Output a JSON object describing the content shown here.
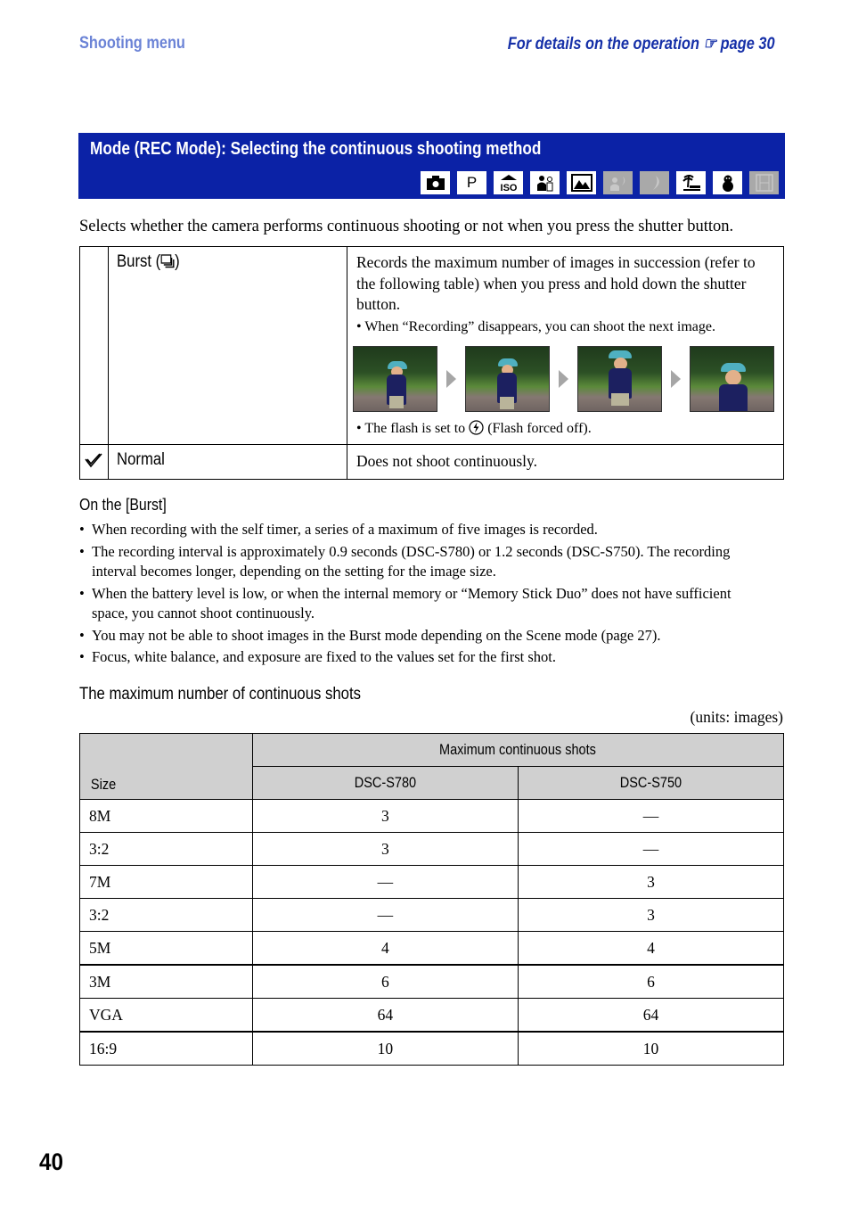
{
  "header": {
    "section": "Shooting menu",
    "reference": "For details on the operation ☞ page 30"
  },
  "banner": {
    "title": "Mode (REC Mode): Selecting the continuous shooting method",
    "mode_icons": [
      {
        "name": "auto-camera-icon",
        "glyph": "",
        "enabled": true
      },
      {
        "name": "program-icon",
        "glyph": "P",
        "enabled": true
      },
      {
        "name": "high-sensitivity-iso-icon",
        "glyph": "ISO",
        "enabled": true
      },
      {
        "name": "soft-snap-icon",
        "glyph": "",
        "enabled": true
      },
      {
        "name": "landscape-icon",
        "glyph": "",
        "enabled": true
      },
      {
        "name": "twilight-portrait-icon",
        "glyph": "",
        "enabled": false
      },
      {
        "name": "twilight-icon",
        "glyph": "",
        "enabled": false
      },
      {
        "name": "beach-icon",
        "glyph": "",
        "enabled": true
      },
      {
        "name": "snow-icon",
        "glyph": "",
        "enabled": true
      },
      {
        "name": "movie-icon",
        "glyph": "",
        "enabled": false
      }
    ]
  },
  "intro": "Selects whether the camera performs continuous shooting or not when you press the shutter button.",
  "options": {
    "burst": {
      "label": "Burst (",
      "label_end": ")",
      "description": "Records the maximum number of images in succession (refer to the following table) when you press and hold down the shutter button.",
      "note1": "When “Recording” disappears, you can shoot the next image.",
      "note2_pre": "The flash is set to ",
      "note2_post": " (Flash forced off)."
    },
    "normal": {
      "label": "Normal",
      "description": "Does not shoot continuously.",
      "default": true
    }
  },
  "notes": {
    "title": "On the [Burst]",
    "items": [
      "When recording with the self timer, a series of a maximum of five images is recorded.",
      "The recording interval is approximately 0.9 seconds (DSC-S780) or 1.2 seconds (DSC-S750). The recording interval becomes longer, depending on the setting for the image size.",
      "When the battery level is low, or when the internal memory or “Memory Stick Duo” does not have sufficient space, you cannot shoot continuously.",
      "You may not be able to shoot images in the Burst mode depending on the Scene mode (page 27).",
      "Focus, white balance, and exposure are fixed to the values set for the first shot."
    ]
  },
  "shots_table": {
    "title": "The maximum number of continuous shots",
    "units": "(units: images)",
    "header_size": "Size",
    "header_group": "Maximum continuous shots",
    "models": [
      "DSC-S780",
      "DSC-S750"
    ],
    "rows": [
      {
        "size": "8M",
        "s780": "3",
        "s750": "—"
      },
      {
        "size": "3:2",
        "s780": "3",
        "s750": "—"
      },
      {
        "size": "7M",
        "s780": "—",
        "s750": "3"
      },
      {
        "size": "3:2",
        "s780": "—",
        "s750": "3"
      },
      {
        "size": "5M",
        "s780": "4",
        "s750": "4"
      },
      {
        "size": "3M",
        "s780": "6",
        "s750": "6"
      },
      {
        "size": "VGA",
        "s780": "64",
        "s750": "64"
      },
      {
        "size": "16:9",
        "s780": "10",
        "s750": "10"
      }
    ]
  },
  "page_number": "40"
}
